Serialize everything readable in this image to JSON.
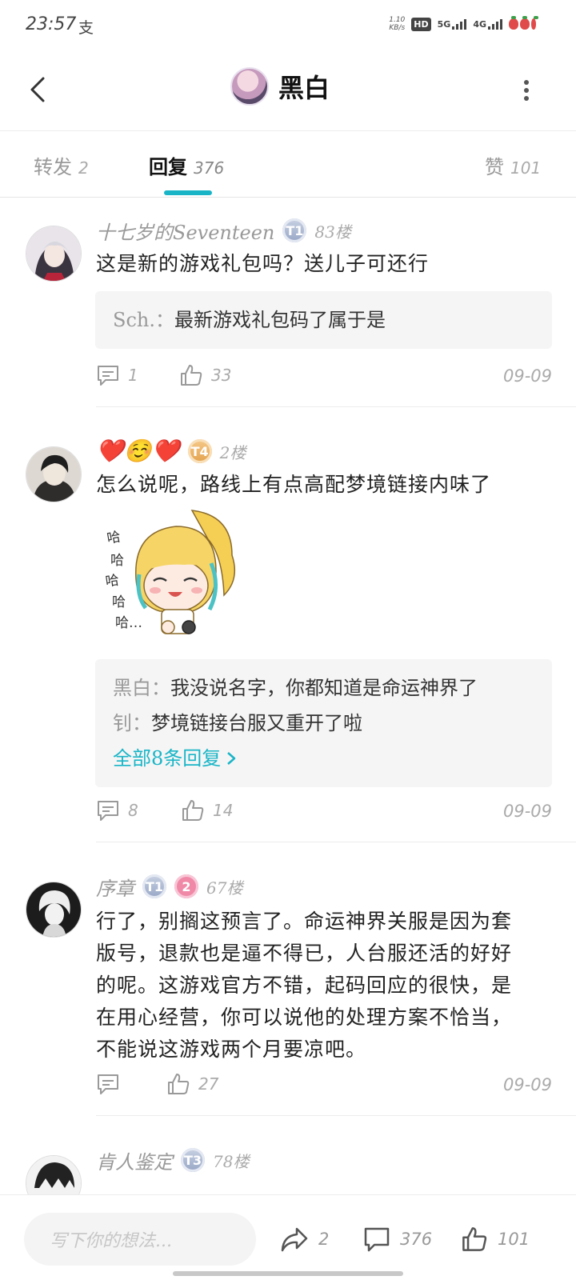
{
  "status_bar": {
    "time": "23:57",
    "carrier_icon": "支",
    "net_speed": "1.10",
    "net_unit": "KB/s",
    "hd": "HD",
    "sim1_network": "5G",
    "sim2_network": "4G"
  },
  "header": {
    "title": "黑白",
    "back_icon": "chevron-left-icon",
    "more_icon": "vertical-dots-icon"
  },
  "tabs": [
    {
      "label": "转发",
      "count": "2",
      "active": false
    },
    {
      "label": "回复",
      "count": "376",
      "active": true
    },
    {
      "label": "赞",
      "count": "101",
      "active": false
    }
  ],
  "accent_color": "#19b5c7",
  "comments": [
    {
      "name": "十七岁的Seventeen",
      "badge": "T1",
      "floor": "83楼",
      "text": "这是新的游戏礼包吗？送儿子可还行",
      "quote": [
        {
          "author": "Sch.：",
          "text": "最新游戏礼包码了属于是"
        }
      ],
      "reply_count": "1",
      "like_count": "33",
      "date": "09-09"
    },
    {
      "name": "❤️☺️❤️",
      "badge": "T4",
      "floor": "2楼",
      "text": "怎么说呢，路线上有点高配梦境链接内味了",
      "sticker_text": "哈哈哈哈哈…",
      "quote": [
        {
          "author": "黑白：",
          "text": "我没说名字，你都知道是命运神界了"
        },
        {
          "author": "钊：",
          "text": "梦境链接台服又重开了啦"
        }
      ],
      "more_replies": "全部8条回复",
      "reply_count": "8",
      "like_count": "14",
      "date": "09-09"
    },
    {
      "name": "序章",
      "badge": "T1",
      "badge2": "2",
      "floor": "67楼",
      "text_lines": [
        "行了，别搁这预言了。命运神界关服是因为套",
        "版号，退款也是逼不得已，人台服还活的好好",
        "的呢。这游戏官方不错，起码回应的很快，是",
        "在用心经营，你可以说他的处理方案不恰当，",
        "不能说这游戏两个月要凉吧。"
      ],
      "reply_count": "",
      "like_count": "27",
      "date": "09-09"
    },
    {
      "name": "肯人鉴定",
      "badge": "T3",
      "floor": "78楼"
    }
  ],
  "bottom_bar": {
    "placeholder": "写下你的想法...",
    "share_count": "2",
    "comment_count": "376",
    "like_count": "101"
  }
}
